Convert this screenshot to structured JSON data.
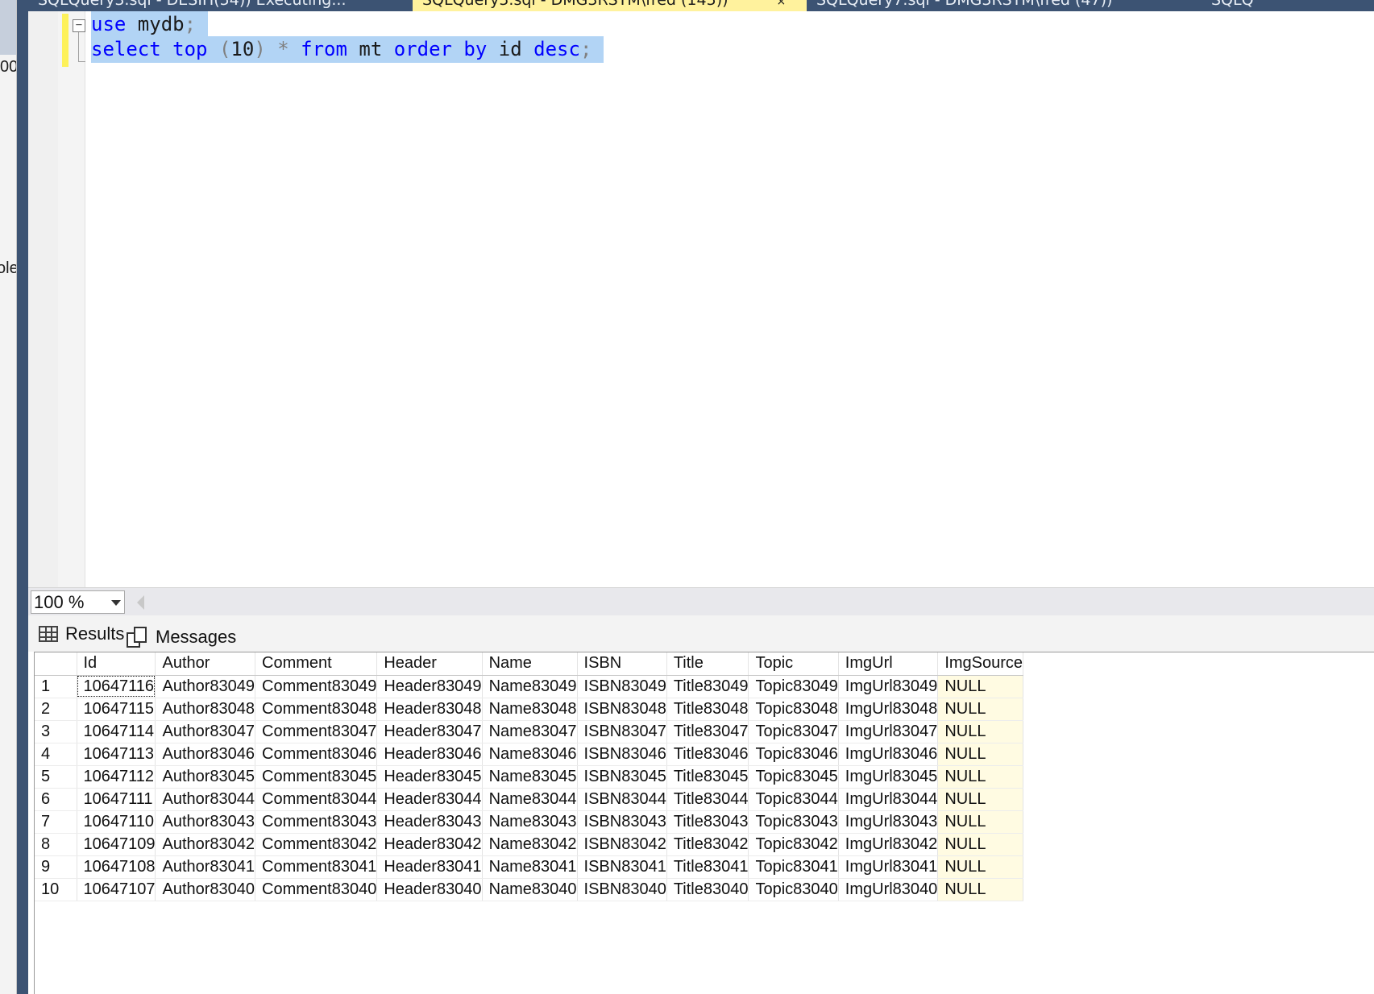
{
  "tabs": [
    {
      "label": "SQLQuery3.sql - DESIH(54)) Executing...",
      "active": false
    },
    {
      "label": "SQLQuery5.sql - DMG3RSTM\\fred (145))",
      "active": true,
      "close": "×"
    },
    {
      "label": "SQLQuery7.sql - DMG3RSTM\\fred (47))",
      "active": false
    },
    {
      "label": "SQLQ",
      "active": false
    }
  ],
  "left_panel": {
    "fragment_top": "00",
    "fragment_mid": "ole"
  },
  "editor": {
    "fold_symbol": "−",
    "line1": {
      "kw1": "use",
      "id1": " mydb",
      "p1": ";"
    },
    "line2": {
      "kw1": "select",
      "kw2": " top",
      "p1": " (",
      "num": "10",
      "p2": ")",
      "star": " *",
      "kw3": " from",
      "id1": " mt",
      "kw4": " order",
      "kw5": " by",
      "id2": " id",
      "kw6": " desc",
      "p3": ";"
    }
  },
  "zoom": {
    "value": "100 %"
  },
  "results_tabs": {
    "results": "Results",
    "messages": "Messages"
  },
  "grid": {
    "columns": [
      "Id",
      "Author",
      "Comment",
      "Header",
      "Name",
      "ISBN",
      "Title",
      "Topic",
      "ImgUrl",
      "ImgSource"
    ],
    "rows": [
      [
        "1",
        "10647116",
        "Author83049",
        "Comment83049",
        "Header83049",
        "Name83049",
        "ISBN83049",
        "Title83049",
        "Topic83049",
        "ImgUrl83049",
        "NULL"
      ],
      [
        "2",
        "10647115",
        "Author83048",
        "Comment83048",
        "Header83048",
        "Name83048",
        "ISBN83048",
        "Title83048",
        "Topic83048",
        "ImgUrl83048",
        "NULL"
      ],
      [
        "3",
        "10647114",
        "Author83047",
        "Comment83047",
        "Header83047",
        "Name83047",
        "ISBN83047",
        "Title83047",
        "Topic83047",
        "ImgUrl83047",
        "NULL"
      ],
      [
        "4",
        "10647113",
        "Author83046",
        "Comment83046",
        "Header83046",
        "Name83046",
        "ISBN83046",
        "Title83046",
        "Topic83046",
        "ImgUrl83046",
        "NULL"
      ],
      [
        "5",
        "10647112",
        "Author83045",
        "Comment83045",
        "Header83045",
        "Name83045",
        "ISBN83045",
        "Title83045",
        "Topic83045",
        "ImgUrl83045",
        "NULL"
      ],
      [
        "6",
        "10647111",
        "Author83044",
        "Comment83044",
        "Header83044",
        "Name83044",
        "ISBN83044",
        "Title83044",
        "Topic83044",
        "ImgUrl83044",
        "NULL"
      ],
      [
        "7",
        "10647110",
        "Author83043",
        "Comment83043",
        "Header83043",
        "Name83043",
        "ISBN83043",
        "Title83043",
        "Topic83043",
        "ImgUrl83043",
        "NULL"
      ],
      [
        "8",
        "10647109",
        "Author83042",
        "Comment83042",
        "Header83042",
        "Name83042",
        "ISBN83042",
        "Title83042",
        "Topic83042",
        "ImgUrl83042",
        "NULL"
      ],
      [
        "9",
        "10647108",
        "Author83041",
        "Comment83041",
        "Header83041",
        "Name83041",
        "ISBN83041",
        "Title83041",
        "Topic83041",
        "ImgUrl83041",
        "NULL"
      ],
      [
        "10",
        "10647107",
        "Author83040",
        "Comment83040",
        "Header83040",
        "Name83040",
        "ISBN83040",
        "Title83040",
        "Topic83040",
        "ImgUrl83040",
        "NULL"
      ]
    ]
  },
  "colors": {
    "tab_bar": "#3c5373",
    "active_tab": "#fff29d",
    "selection": "#b2d4f5",
    "keyword": "#0000ff",
    "null_cell": "#fffbe2"
  }
}
